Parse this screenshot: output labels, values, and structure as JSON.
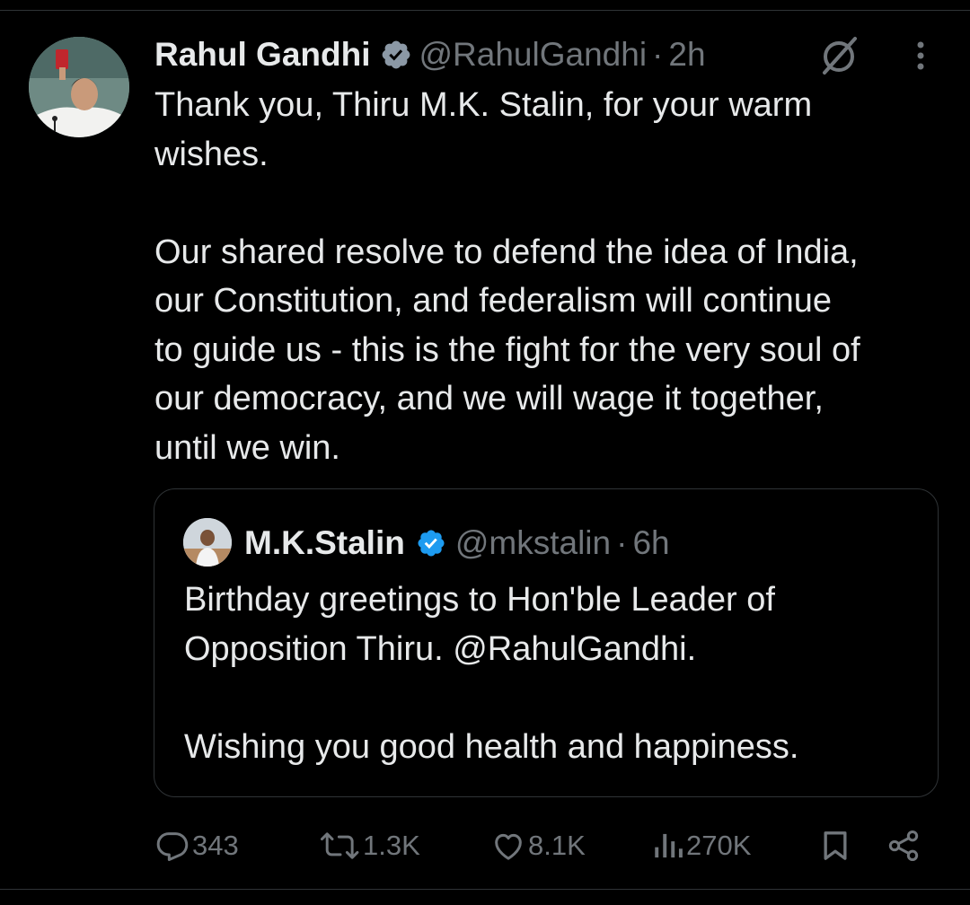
{
  "tweet": {
    "author_name": "Rahul Gandhi",
    "handle": "@RahulGandhi",
    "separator": "·",
    "time": "2h",
    "text_lines_p1": [
      "Thank you, Thiru M.K. Stalin, for your warm",
      "wishes."
    ],
    "text_lines_p2": [
      "Our shared resolve to defend the idea of India,",
      "our Constitution, and federalism will continue",
      "to guide us - this is the fight for the very soul of",
      "our democracy, and we will wage it together,",
      "until we win."
    ]
  },
  "quote": {
    "author_name": "M.K.Stalin",
    "handle": "@mkstalin",
    "separator": "·",
    "time": "6h",
    "text_lines_p1": [
      "Birthday greetings to Hon'ble Leader of",
      "Opposition Thiru. @RahulGandhi."
    ],
    "text_lines_p2": [
      "Wishing you good health and happiness."
    ]
  },
  "actions": {
    "replies": "343",
    "reposts": "1.3K",
    "likes": "8.1K",
    "views": "270K"
  },
  "icons": {
    "verified": "verified-badge-icon",
    "grok": "grok-icon",
    "more": "more-vertical-icon",
    "reply": "reply-icon",
    "repost": "repost-icon",
    "like": "heart-icon",
    "views": "views-icon",
    "bookmark": "bookmark-icon",
    "share": "share-icon"
  },
  "colors": {
    "background": "#000000",
    "text": "#e7e9ea",
    "muted": "#71767b",
    "border": "#2f3336",
    "verified": "#1d9bf0"
  }
}
